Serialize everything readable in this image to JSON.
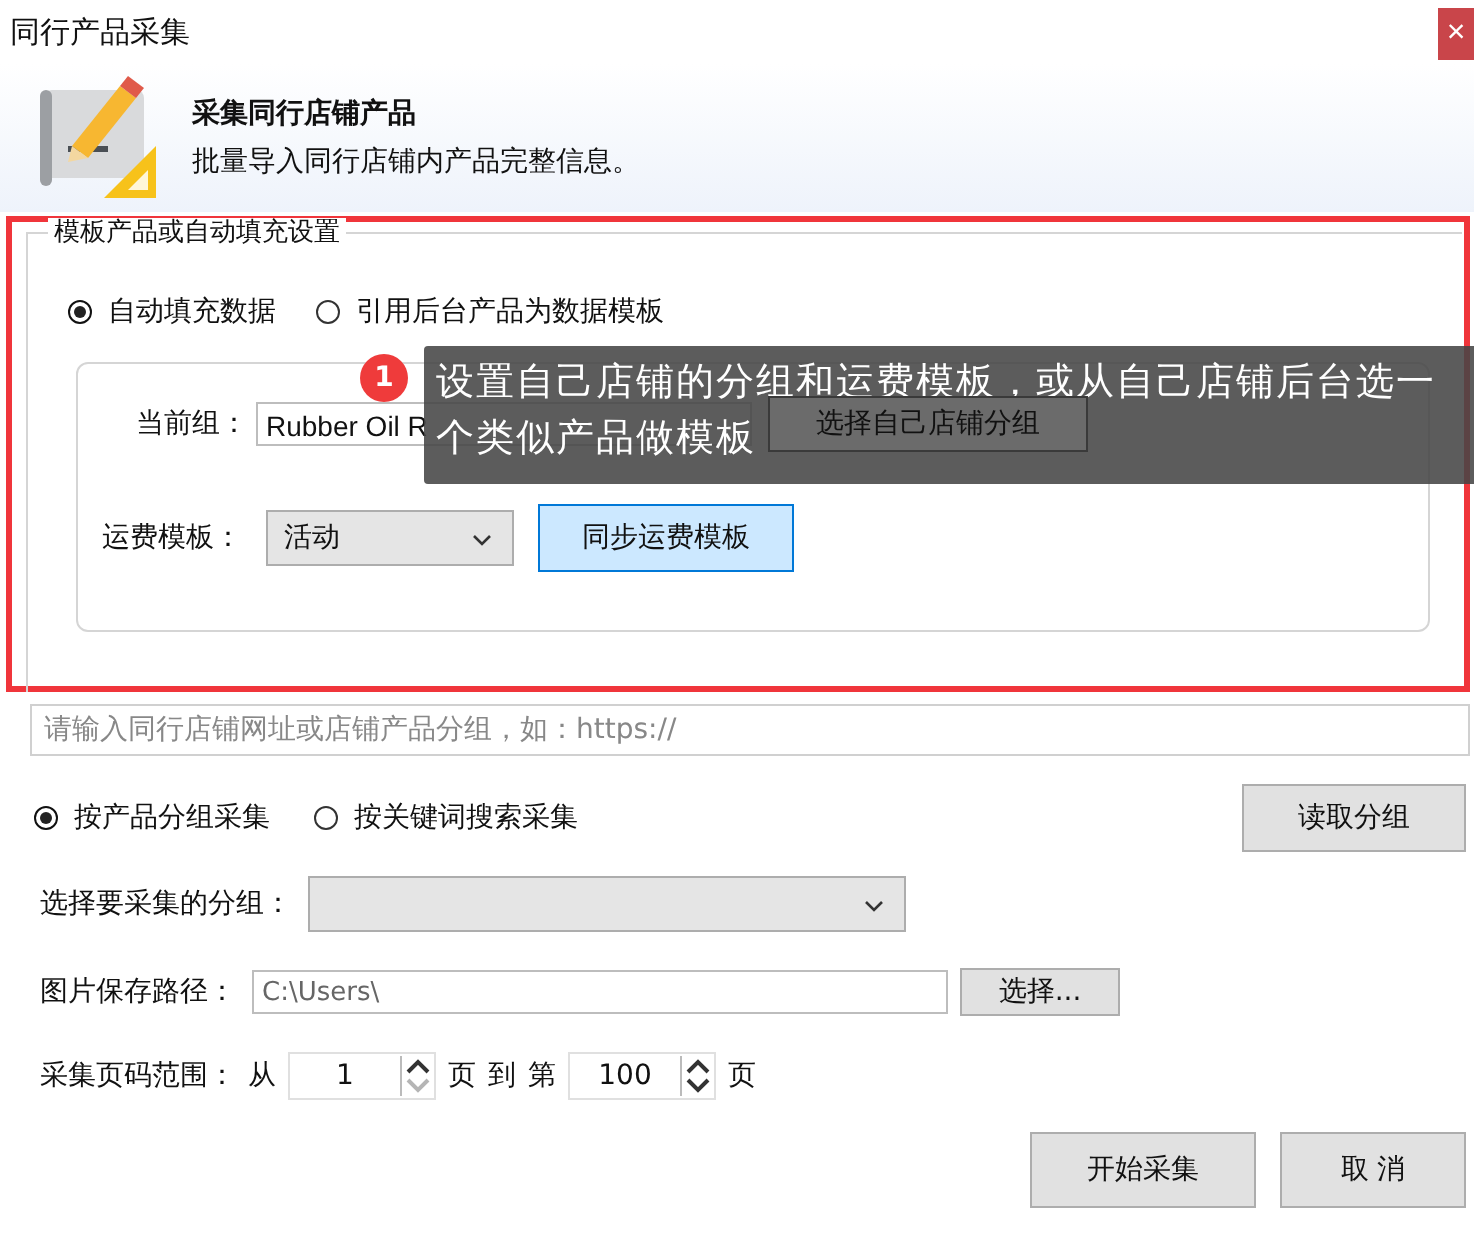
{
  "window": {
    "title": "同行产品采集",
    "close": "×"
  },
  "header": {
    "title": "采集同行店铺产品",
    "subtitle": "批量导入同行店铺内产品完整信息。"
  },
  "template_group": {
    "title": "模板产品或自动填充设置",
    "highlighted": true,
    "modes": [
      {
        "label": "自动填充数据",
        "selected": true
      },
      {
        "label": "引用后台产品为数据模板",
        "selected": false
      }
    ],
    "current_group": {
      "label": "当前组：",
      "value": "Rubber Oil R",
      "button": "选择自己店铺分组"
    },
    "freight": {
      "label": "运费模板：",
      "value": "活动",
      "button": "同步运费模板"
    }
  },
  "tooltip": {
    "badge": "1",
    "text": "设置自己店铺的分组和运费模板，或从自己店铺后台选一个类似产品做模板"
  },
  "url_field": {
    "placeholder": "请输入同行店铺网址或店铺产品分组，如：https://"
  },
  "collect_modes": [
    {
      "label": "按产品分组采集",
      "selected": true
    },
    {
      "label": "按关键词搜索采集",
      "selected": false
    }
  ],
  "read_button": "读取分组",
  "group_select": {
    "label": "选择要采集的分组："
  },
  "save_path": {
    "label": "图片保存路径：",
    "value": "C:\\Users\\",
    "button": "选择..."
  },
  "page_range": {
    "label": "采集页码范围：",
    "from_label": "从",
    "from": "1",
    "from_down_disabled": true,
    "mid_labels": [
      "页",
      "到",
      "第"
    ],
    "to": "100",
    "to_down_disabled": false,
    "end_label": "页"
  },
  "buttons": [
    "开始采集",
    "取 消"
  ]
}
